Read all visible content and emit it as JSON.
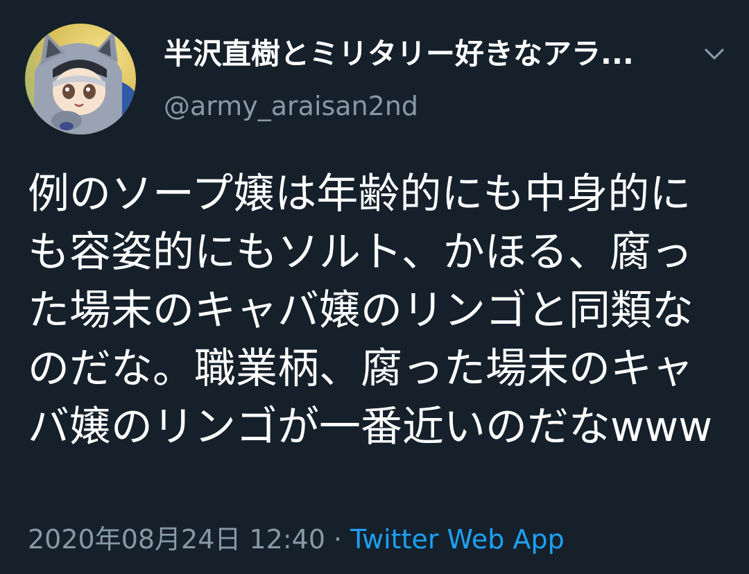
{
  "tweet": {
    "display_name": "半沢直樹とミリタリー好きなアラ...",
    "handle": "@army_araisan2nd",
    "text": "例のソープ嬢は年齢的にも中身的にも容姿的にもソルト、かほる、腐った場末のキャバ嬢のリンゴと同類なのだな。職業柄、腐った場末のキャバ嬢のリンゴが一番近いのだなwww",
    "timestamp": "2020年08月24日 12:40",
    "separator": "·",
    "source": "Twitter Web App"
  },
  "icons": {
    "avatar": "anime-character-avatar",
    "menu": "chevron-down-icon"
  },
  "colors": {
    "background": "#15202b",
    "primary_text": "#ffffff",
    "secondary_text": "#8899a6",
    "link": "#1da1f2"
  }
}
